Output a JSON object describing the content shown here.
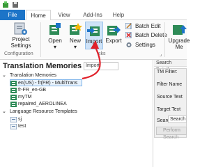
{
  "quick_access": {
    "undo_icon": "undo-icon",
    "save_icon": "save-icon"
  },
  "tabs": [
    {
      "label": "File"
    },
    {
      "label": "Home"
    },
    {
      "label": "View"
    },
    {
      "label": "Add-Ins"
    },
    {
      "label": "Help"
    }
  ],
  "ribbon": {
    "project_settings": {
      "line1": "Project",
      "line2": "Settings"
    },
    "configuration_label": "Configuration",
    "open": "Open",
    "new": "New",
    "import": "Import",
    "export": "Export",
    "tasks_label": "sks",
    "batch_edit": "Batch Edit",
    "batch_delete": "Batch Delete",
    "settings": "Settings",
    "upgrade": {
      "line1": "Upgrade",
      "line2": "Me"
    }
  },
  "left_pane": {
    "title": "Translation Memories",
    "input_value": "Import",
    "tree": {
      "tm_group": "Translation Memories",
      "tm_items": [
        "en(US) - fr(FR) - MultiTrans",
        "fr-FR_en-GB",
        "myTM",
        "repaired_AEROLINEA"
      ],
      "lr_group": "Language Resource Templates",
      "lr_items": [
        "sj",
        "test"
      ]
    }
  },
  "right_pane": {
    "search_details": "Search Details",
    "tm_filter": "TM Filter:",
    "fields": [
      "Filter Name",
      "Source Text",
      "Target Text",
      "Search Type"
    ],
    "search_type_value": "Search",
    "perform_search": "Perform Search"
  },
  "colors": {
    "accent": "#1c74c8",
    "selection": "#e8f2fc",
    "arrow": "#e0202a"
  }
}
